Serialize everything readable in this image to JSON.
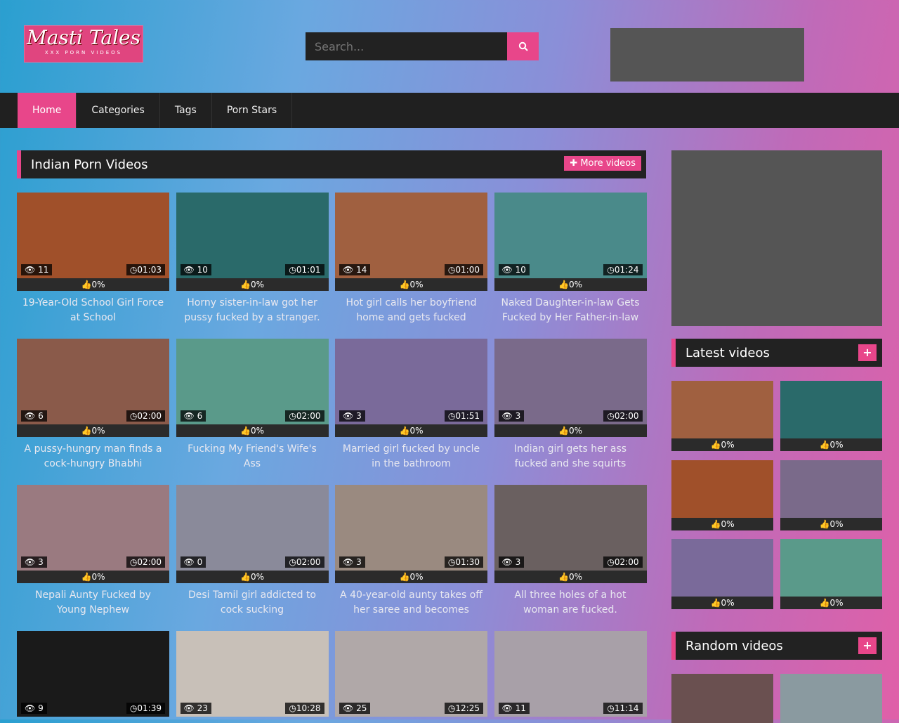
{
  "site": {
    "logo_title": "Masti Tales",
    "logo_sub": "XXX PORN VIDEOS"
  },
  "search": {
    "placeholder": "Search..."
  },
  "nav": [
    "Home",
    "Categories",
    "Tags",
    "Porn Stars"
  ],
  "main": {
    "heading": "Indian Porn Videos",
    "more_label": "More videos",
    "videos": [
      {
        "views": "11",
        "duration": "01:03",
        "rating": "0%",
        "title": "19-Year-Old School Girl Force at School",
        "color": "#a0502a"
      },
      {
        "views": "10",
        "duration": "01:01",
        "rating": "0%",
        "title": "Horny sister-in-law got her pussy fucked by a stranger.",
        "color": "#2a6a6a"
      },
      {
        "views": "14",
        "duration": "01:00",
        "rating": "0%",
        "title": "Hot girl calls her boyfriend home and gets fucked",
        "color": "#a06040"
      },
      {
        "views": "10",
        "duration": "01:24",
        "rating": "0%",
        "title": "Naked Daughter-in-law Gets Fucked by Her Father-in-law",
        "color": "#4a8a8a"
      },
      {
        "views": "6",
        "duration": "02:00",
        "rating": "0%",
        "title": "A pussy-hungry man finds a cock-hungry Bhabhi",
        "color": "#8a5a4a"
      },
      {
        "views": "6",
        "duration": "02:00",
        "rating": "0%",
        "title": "Fucking My Friend's Wife's Ass",
        "color": "#5a9a8a"
      },
      {
        "views": "3",
        "duration": "01:51",
        "rating": "0%",
        "title": "Married girl fucked by uncle in the bathroom",
        "color": "#7a6a9a"
      },
      {
        "views": "3",
        "duration": "02:00",
        "rating": "0%",
        "title": "Indian girl gets her ass fucked and she squirts",
        "color": "#7a6a8a"
      },
      {
        "views": "3",
        "duration": "02:00",
        "rating": "0%",
        "title": "Nepali Aunty Fucked by Young Nephew",
        "color": "#9a7a80"
      },
      {
        "views": "0",
        "duration": "02:00",
        "rating": "0%",
        "title": "Desi Tamil girl addicted to cock sucking",
        "color": "#8a8a9a"
      },
      {
        "views": "3",
        "duration": "01:30",
        "rating": "0%",
        "title": "A 40-year-old aunty takes off her saree and becomes",
        "color": "#9a8a80"
      },
      {
        "views": "3",
        "duration": "02:00",
        "rating": "0%",
        "title": "All three holes of a hot woman are fucked.",
        "color": "#6a6060"
      },
      {
        "views": "9",
        "duration": "01:39",
        "rating": "",
        "title": "",
        "color": "#1a1a1a"
      },
      {
        "views": "23",
        "duration": "10:28",
        "rating": "",
        "title": "",
        "color": "#c8c0b8"
      },
      {
        "views": "25",
        "duration": "12:25",
        "rating": "",
        "title": "",
        "color": "#b0a8a8"
      },
      {
        "views": "11",
        "duration": "11:14",
        "rating": "",
        "title": "",
        "color": "#a8a0a8"
      }
    ]
  },
  "sidebar": {
    "latest_heading": "Latest videos",
    "random_heading": "Random videos",
    "latest": [
      {
        "rating": "0%",
        "color": "#a06040"
      },
      {
        "rating": "0%",
        "color": "#2a6a6a"
      },
      {
        "rating": "0%",
        "color": "#a0502a"
      },
      {
        "rating": "0%",
        "color": "#7a6a8a"
      },
      {
        "rating": "0%",
        "color": "#7a6a9a"
      },
      {
        "rating": "0%",
        "color": "#5a9a8a"
      }
    ],
    "random": [
      {
        "color": "#6a5050"
      },
      {
        "color": "#8a9aa0"
      }
    ]
  },
  "colors": {
    "accent": "#e8468a",
    "bar": "#222222"
  }
}
